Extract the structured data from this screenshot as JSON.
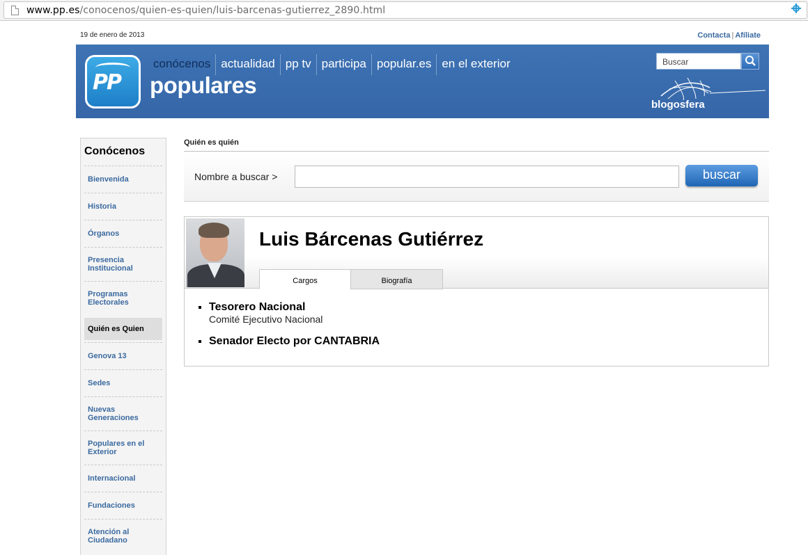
{
  "browser": {
    "url_host": "www.pp.es",
    "url_path": "/conocenos/quien-es-quien/luis-barcenas-gutierrez_2890.html"
  },
  "topbar": {
    "date": "19 de enero de 2013",
    "links": [
      "Contacta",
      "Afíliate"
    ],
    "separator": "|"
  },
  "header": {
    "logo_text": "PP",
    "brand": "populares",
    "nav": [
      "conócenos",
      "actualidad",
      "pp tv",
      "participa",
      "popular.es",
      "en el exterior"
    ],
    "search_placeholder": "Buscar",
    "blog_label": "blogosfera",
    "colors": {
      "banner": "#3566a8",
      "active_nav": "#0f2e5a"
    }
  },
  "sidebar": {
    "title": "Conócenos",
    "items": [
      {
        "label": "Bienvenida"
      },
      {
        "label": "Historia"
      },
      {
        "label": "Órganos"
      },
      {
        "label": "Presencia Institucional"
      },
      {
        "label": "Programas Electorales"
      },
      {
        "label": "Quién es Quien",
        "active": true
      },
      {
        "label": "Genova 13"
      },
      {
        "label": "Sedes"
      },
      {
        "label": "Nuevas Generaciones"
      },
      {
        "label": "Populares en el Exterior"
      },
      {
        "label": "Internacional"
      },
      {
        "label": "Fundaciones"
      },
      {
        "label": "Atención al Ciudadano"
      }
    ]
  },
  "main": {
    "breadcrumb": "Quién es quién",
    "search_label": "Nombre a buscar >",
    "search_value": "",
    "search_button": "buscar"
  },
  "profile": {
    "name": "Luis Bárcenas Gutiérrez",
    "tabs": [
      {
        "label": "Cargos",
        "active": true
      },
      {
        "label": "Biografía",
        "active": false
      }
    ],
    "cargos": [
      {
        "title": "Tesorero Nacional",
        "detail": "Comité Ejecutivo Nacional"
      },
      {
        "title": "Senador Electo por CANTABRIA",
        "detail": ""
      }
    ]
  }
}
